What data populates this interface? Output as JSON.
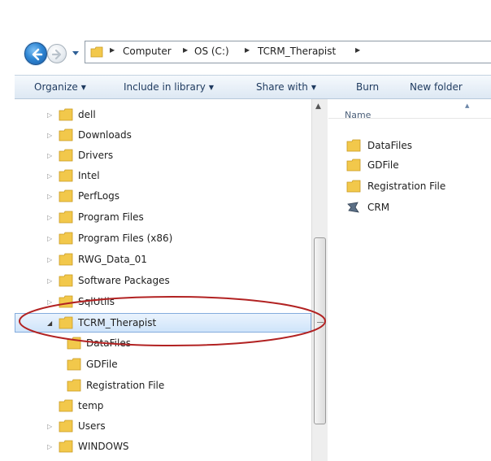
{
  "address_bar": {
    "crumbs": [
      "Computer",
      "OS (C:)",
      "TCRM_Therapist"
    ]
  },
  "toolbar": {
    "organize": "Organize",
    "include_in_library": "Include in library",
    "share_with": "Share with",
    "burn": "Burn",
    "new_folder": "New folder"
  },
  "tree": {
    "items": [
      {
        "label": "dell"
      },
      {
        "label": "Downloads"
      },
      {
        "label": "Drivers"
      },
      {
        "label": "Intel"
      },
      {
        "label": "PerfLogs"
      },
      {
        "label": "Program Files"
      },
      {
        "label": "Program Files (x86)"
      },
      {
        "label": "RWG_Data_01"
      },
      {
        "label": "Software Packages"
      },
      {
        "label": "SqlUtils"
      },
      {
        "label": "TCRM_Therapist"
      },
      {
        "label": "DataFiles"
      },
      {
        "label": "GDFile"
      },
      {
        "label": "Registration File"
      },
      {
        "label": "temp"
      },
      {
        "label": "Users"
      },
      {
        "label": "WINDOWS"
      }
    ]
  },
  "content": {
    "column_name": "Name",
    "items": [
      {
        "label": "DataFiles"
      },
      {
        "label": "GDFile"
      },
      {
        "label": "Registration File"
      },
      {
        "label": "CRM"
      }
    ]
  },
  "colors": {
    "highlight_ellipse": "#b22222",
    "folder_yellow": "#f2c84b",
    "selection": "#cfe4fa"
  }
}
